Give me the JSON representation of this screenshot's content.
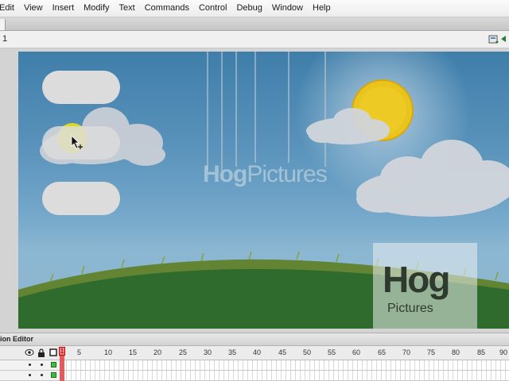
{
  "menubar": {
    "items": [
      "Edit",
      "View",
      "Insert",
      "Modify",
      "Text",
      "Commands",
      "Control",
      "Debug",
      "Window",
      "Help"
    ]
  },
  "editbar": {
    "scene_label": "1"
  },
  "stage": {
    "watermark_text_bold": "Hog",
    "watermark_text_thin": "Pictures",
    "watermark_box_hog": "Hog",
    "watermark_box_pictures": "Pictures"
  },
  "timeline": {
    "title": "tion Editor",
    "playhead_label": "1",
    "frame_numbers": [
      "5",
      "10",
      "15",
      "20",
      "25",
      "30",
      "35",
      "40",
      "45",
      "50",
      "55",
      "60",
      "65",
      "70",
      "75",
      "80",
      "85",
      "90"
    ]
  },
  "colors": {
    "sky_top": "#3f7eaa",
    "grass": "#2f6b2c",
    "sun": "#e8c41d",
    "button_fill": "#dcdcdc",
    "highlight": "#f3e600"
  },
  "icons": [
    "eye-icon",
    "lock-icon",
    "outline-icon",
    "scene-edit-icon",
    "symbol-edit-icon",
    "arrow-cursor-icon"
  ]
}
